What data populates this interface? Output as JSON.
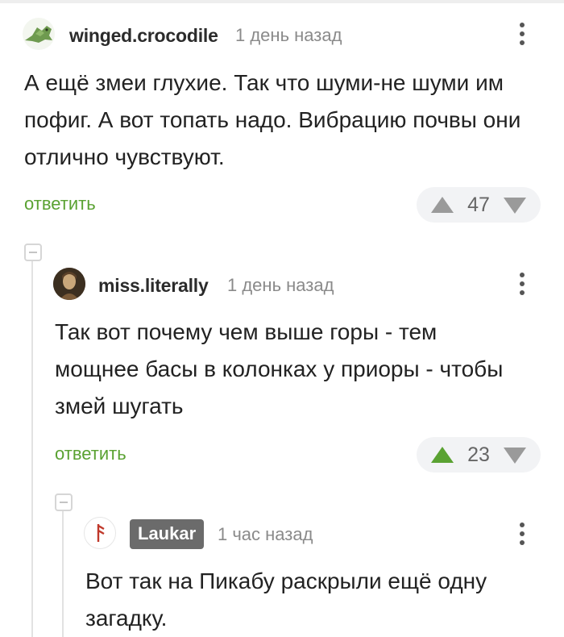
{
  "comments": [
    {
      "username": "winged.crocodile",
      "time": "1 день назад",
      "text": "А ещё змеи глухие. Так что шуми-не шуми им пофиг. А вот топать надо. Вибрацию почвы они отлично чувствуют.",
      "reply_label": "ответить",
      "rating": "47",
      "upvoted": false
    },
    {
      "username": "miss.literally",
      "time": "1 день назад",
      "text": "Так вот почему чем выше горы - тем мощнее басы в колонках у приоры - чтобы змей шугать",
      "reply_label": "ответить",
      "rating": "23",
      "upvoted": true
    },
    {
      "username": "Laukar",
      "time": "1 час назад",
      "text": "Вот так на Пикабу раскрыли ещё одну загадку.",
      "author_badge": true
    }
  ],
  "colors": {
    "reply": "#5aa232",
    "upvote_active": "#5aa232",
    "rating_bg": "#f2f3f5",
    "author_badge_bg": "#6b6b6b"
  },
  "icons": {
    "menu": "vertical-ellipsis-icon",
    "up": "triangle-up-icon",
    "down": "triangle-down-icon",
    "collapse": "minus-square-icon",
    "avatar_1": "crocodile-avatar",
    "avatar_2": "portrait-avatar",
    "avatar_3": "rune-avatar"
  }
}
